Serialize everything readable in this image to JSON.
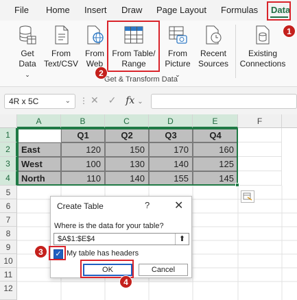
{
  "tabs": [
    {
      "label": "File",
      "active": false
    },
    {
      "label": "Home",
      "active": false
    },
    {
      "label": "Insert",
      "active": false
    },
    {
      "label": "Draw",
      "active": false
    },
    {
      "label": "Page Layout",
      "active": false
    },
    {
      "label": "Formulas",
      "active": false
    },
    {
      "label": "Data",
      "active": true
    }
  ],
  "ribbon": {
    "buttons": [
      {
        "line1": "Get",
        "line2": "Data"
      },
      {
        "line1": "From",
        "line2": "Text/CSV"
      },
      {
        "line1": "From",
        "line2": "Web"
      },
      {
        "line1": "From Table/",
        "line2": "Range"
      },
      {
        "line1": "From",
        "line2": "Picture"
      },
      {
        "line1": "Recent",
        "line2": "Sources"
      },
      {
        "line1": "Existing",
        "line2": "Connections"
      }
    ],
    "group_label": "Get & Transform Data"
  },
  "formula_bar": {
    "name_box": "4R x 5C",
    "fx": "fx",
    "formula": ""
  },
  "grid": {
    "columns": [
      "A",
      "B",
      "C",
      "D",
      "E",
      "F"
    ],
    "rows": [
      "1",
      "2",
      "3",
      "4",
      "5",
      "6",
      "7",
      "8",
      "9",
      "10",
      "11",
      "12"
    ],
    "header_row": [
      "Q1",
      "Q2",
      "Q3",
      "Q4"
    ],
    "data": [
      {
        "label": "East",
        "values": [
          "120",
          "150",
          "170",
          "160"
        ]
      },
      {
        "label": "West",
        "values": [
          "100",
          "130",
          "140",
          "125"
        ]
      },
      {
        "label": "North",
        "values": [
          "110",
          "140",
          "155",
          "145"
        ]
      }
    ]
  },
  "dialog": {
    "title": "Create Table",
    "help": "?",
    "close": "✕",
    "question": "Where is the data for your table?",
    "range_value": "$A$1:$E$4",
    "has_headers_label": "My table has headers",
    "has_headers_checked": true,
    "ok_label": "OK",
    "cancel_label": "Cancel"
  },
  "annotations": [
    "1",
    "2",
    "3",
    "4"
  ],
  "colors": {
    "accent_green": "#1f6e43",
    "annotation_red": "#d9232a",
    "dialog_blue": "#1f5ec0"
  }
}
